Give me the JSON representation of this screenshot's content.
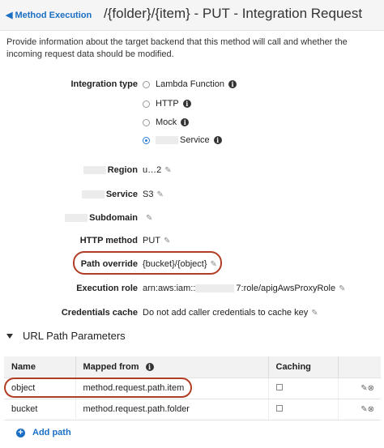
{
  "header": {
    "back_label": "Method Execution",
    "title": "/{folder}/{item} - PUT - Integration Request"
  },
  "intro": "Provide information about the target backend that this method will call and whether the incoming request data should be modified.",
  "integration_type": {
    "label": "Integration type",
    "options": [
      {
        "label": "Lambda Function",
        "selected": false
      },
      {
        "label": "HTTP",
        "selected": false
      },
      {
        "label": "Mock",
        "selected": false
      },
      {
        "label": "Service",
        "selected": true
      }
    ]
  },
  "fields": {
    "region": {
      "label": "Region",
      "value": "u…2"
    },
    "service": {
      "label": "Service",
      "value": "S3"
    },
    "subdomain": {
      "label": "Subdomain",
      "value": ""
    },
    "http_method": {
      "label": "HTTP method",
      "value": "PUT"
    },
    "path_override": {
      "label": "Path override",
      "value": "{bucket}/{object}"
    },
    "execution_role": {
      "label": "Execution role",
      "value_prefix": "arn:aws:iam::",
      "value_suffix": "7:role/apigAwsProxyRole"
    },
    "credentials_cache": {
      "label": "Credentials cache",
      "value": "Do not add caller credentials to cache key"
    }
  },
  "url_path_parameters": {
    "title": "URL Path Parameters",
    "columns": [
      "Name",
      "Mapped from",
      "Caching"
    ],
    "rows": [
      {
        "name": "object",
        "mapped_from": "method.request.path.item",
        "caching": false
      },
      {
        "name": "bucket",
        "mapped_from": "method.request.path.folder",
        "caching": false
      }
    ],
    "add_label": "Add path"
  },
  "colors": {
    "link": "#1a6fc4",
    "highlight": "#b23d25"
  },
  "icons": [
    "left-arrow-icon",
    "info-icon",
    "pencil-icon",
    "remove-icon",
    "plus-icon",
    "caret-down-icon"
  ]
}
